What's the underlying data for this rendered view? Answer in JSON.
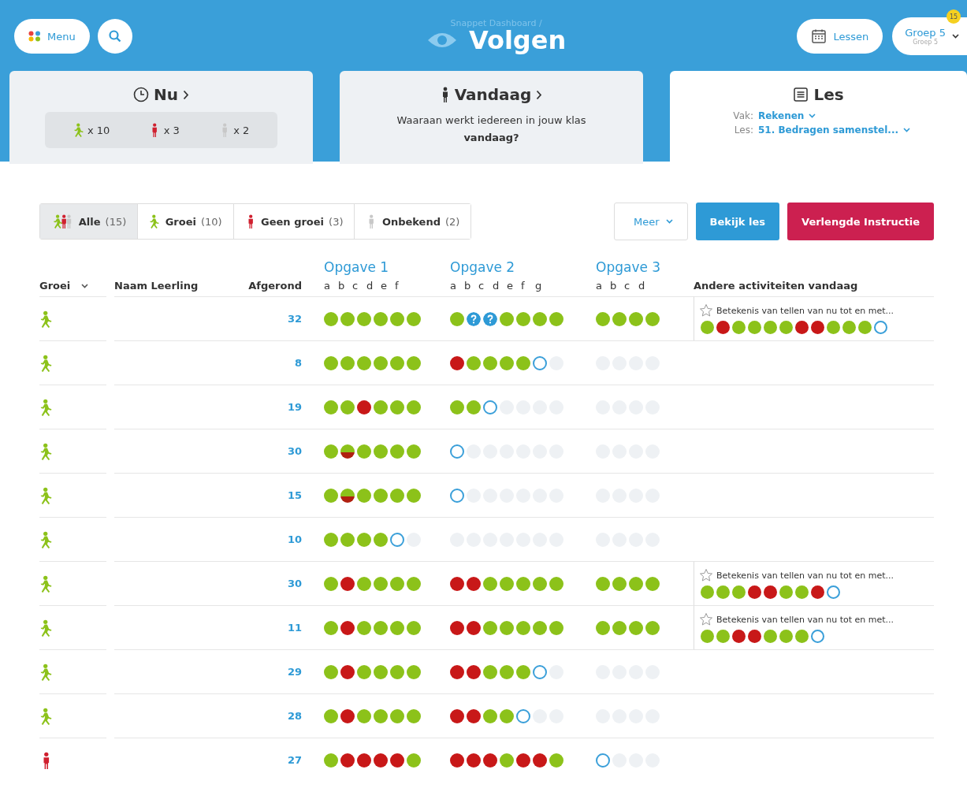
{
  "header": {
    "menu_button": "Menu",
    "breadcrumb": "Snappet Dashboard /",
    "title": "Volgen",
    "lessons_button": "Lessen",
    "group_selector": {
      "label": "Groep 5",
      "sublabel": "Groep 5",
      "badge": "15"
    }
  },
  "cards": [
    {
      "kind": "now",
      "title": "Nu",
      "selected": false,
      "counts": [
        {
          "kind": "growth",
          "text": "x 10"
        },
        {
          "kind": "no_growth",
          "text": "x 3"
        },
        {
          "kind": "unknown",
          "text": "x 2"
        }
      ]
    },
    {
      "kind": "today",
      "title": "Vandaag",
      "selected": false,
      "text": "Waaraan werkt iedereen in jouw klas **vandaag?**"
    },
    {
      "kind": "lesson",
      "title": "Les",
      "selected": true,
      "fields": [
        {
          "label": "Vak:",
          "value": "Rekenen"
        },
        {
          "label": "Les:",
          "value": "51. Bedragen samenstel..."
        }
      ]
    }
  ],
  "filters": [
    {
      "kind": "all",
      "label": "Alle",
      "count": "(15)",
      "selected": true
    },
    {
      "kind": "growth",
      "label": "Groei",
      "count": "(10)",
      "selected": false
    },
    {
      "kind": "no_growth",
      "label": "Geen groei",
      "count": "(3)",
      "selected": false
    },
    {
      "kind": "unknown",
      "label": "Onbekend",
      "count": "(2)",
      "selected": false
    }
  ],
  "actions": [
    {
      "kind": "dropdown",
      "label": "Meer"
    },
    {
      "kind": "primary",
      "label": "Bekijk les"
    },
    {
      "kind": "danger",
      "label": "Verlengde Instructie"
    }
  ],
  "table": {
    "columns": {
      "growth": "Groei",
      "name": "Naam Leerling",
      "done": "Afgerond",
      "other": "Andere activiteiten vandaag"
    },
    "exercises": [
      {
        "title": "Opgave 1",
        "parts": [
          "a",
          "b",
          "c",
          "d",
          "e",
          "f"
        ]
      },
      {
        "title": "Opgave 2",
        "parts": [
          "a",
          "b",
          "c",
          "d",
          "e",
          "f",
          "g"
        ]
      },
      {
        "title": "Opgave 3",
        "parts": [
          "a",
          "b",
          "c",
          "d"
        ]
      }
    ],
    "rows": [
      {
        "kind": "growth",
        "done": "32",
        "results": [
          [
            {
              "kind": "correct"
            },
            {
              "kind": "correct"
            },
            {
              "kind": "correct"
            },
            {
              "kind": "correct"
            },
            {
              "kind": "correct"
            },
            {
              "kind": "correct"
            }
          ],
          [
            {
              "kind": "correct"
            },
            {
              "kind": "question"
            },
            {
              "kind": "question"
            },
            {
              "kind": "correct"
            },
            {
              "kind": "correct"
            },
            {
              "kind": "correct"
            },
            {
              "kind": "correct"
            }
          ],
          [
            {
              "kind": "correct"
            },
            {
              "kind": "correct"
            },
            {
              "kind": "correct"
            },
            {
              "kind": "correct"
            }
          ]
        ],
        "other": {
          "title": "Betekenis van tellen van nu tot en met...",
          "results": [
            {
              "kind": "correct"
            },
            {
              "kind": "wrong"
            },
            {
              "kind": "correct"
            },
            {
              "kind": "correct"
            },
            {
              "kind": "correct"
            },
            {
              "kind": "correct"
            },
            {
              "kind": "wrong"
            },
            {
              "kind": "wrong"
            },
            {
              "kind": "correct"
            },
            {
              "kind": "correct"
            },
            {
              "kind": "correct"
            },
            {
              "kind": "open"
            }
          ]
        }
      },
      {
        "kind": "growth",
        "done": "8",
        "results": [
          [
            {
              "kind": "correct"
            },
            {
              "kind": "correct"
            },
            {
              "kind": "correct"
            },
            {
              "kind": "correct"
            },
            {
              "kind": "correct"
            },
            {
              "kind": "correct"
            }
          ],
          [
            {
              "kind": "wrong"
            },
            {
              "kind": "correct"
            },
            {
              "kind": "correct"
            },
            {
              "kind": "correct"
            },
            {
              "kind": "correct"
            },
            {
              "kind": "open"
            },
            {
              "kind": "empty"
            }
          ],
          [
            {
              "kind": "empty"
            },
            {
              "kind": "empty"
            },
            {
              "kind": "empty"
            },
            {
              "kind": "empty"
            }
          ]
        ]
      },
      {
        "kind": "growth",
        "done": "19",
        "results": [
          [
            {
              "kind": "correct"
            },
            {
              "kind": "correct"
            },
            {
              "kind": "wrong"
            },
            {
              "kind": "correct"
            },
            {
              "kind": "correct"
            },
            {
              "kind": "correct"
            }
          ],
          [
            {
              "kind": "correct"
            },
            {
              "kind": "correct"
            },
            {
              "kind": "open"
            },
            {
              "kind": "empty"
            },
            {
              "kind": "empty"
            },
            {
              "kind": "empty"
            },
            {
              "kind": "empty"
            }
          ],
          [
            {
              "kind": "empty"
            },
            {
              "kind": "empty"
            },
            {
              "kind": "empty"
            },
            {
              "kind": "empty"
            }
          ]
        ]
      },
      {
        "kind": "growth",
        "done": "30",
        "results": [
          [
            {
              "kind": "correct"
            },
            {
              "kind": "partial"
            },
            {
              "kind": "correct"
            },
            {
              "kind": "correct"
            },
            {
              "kind": "correct"
            },
            {
              "kind": "correct"
            }
          ],
          [
            {
              "kind": "open"
            },
            {
              "kind": "empty"
            },
            {
              "kind": "empty"
            },
            {
              "kind": "empty"
            },
            {
              "kind": "empty"
            },
            {
              "kind": "empty"
            },
            {
              "kind": "empty"
            }
          ],
          [
            {
              "kind": "empty"
            },
            {
              "kind": "empty"
            },
            {
              "kind": "empty"
            },
            {
              "kind": "empty"
            }
          ]
        ]
      },
      {
        "kind": "growth",
        "done": "15",
        "results": [
          [
            {
              "kind": "correct"
            },
            {
              "kind": "partial"
            },
            {
              "kind": "correct"
            },
            {
              "kind": "correct"
            },
            {
              "kind": "correct"
            },
            {
              "kind": "correct"
            }
          ],
          [
            {
              "kind": "open"
            },
            {
              "kind": "empty"
            },
            {
              "kind": "empty"
            },
            {
              "kind": "empty"
            },
            {
              "kind": "empty"
            },
            {
              "kind": "empty"
            },
            {
              "kind": "empty"
            }
          ],
          [
            {
              "kind": "empty"
            },
            {
              "kind": "empty"
            },
            {
              "kind": "empty"
            },
            {
              "kind": "empty"
            }
          ]
        ]
      },
      {
        "kind": "growth",
        "done": "10",
        "results": [
          [
            {
              "kind": "correct"
            },
            {
              "kind": "correct"
            },
            {
              "kind": "correct"
            },
            {
              "kind": "correct"
            },
            {
              "kind": "open"
            },
            {
              "kind": "empty"
            }
          ],
          [
            {
              "kind": "empty"
            },
            {
              "kind": "empty"
            },
            {
              "kind": "empty"
            },
            {
              "kind": "empty"
            },
            {
              "kind": "empty"
            },
            {
              "kind": "empty"
            },
            {
              "kind": "empty"
            }
          ],
          [
            {
              "kind": "empty"
            },
            {
              "kind": "empty"
            },
            {
              "kind": "empty"
            },
            {
              "kind": "empty"
            }
          ]
        ]
      },
      {
        "kind": "growth",
        "done": "30",
        "results": [
          [
            {
              "kind": "correct"
            },
            {
              "kind": "wrong"
            },
            {
              "kind": "correct"
            },
            {
              "kind": "correct"
            },
            {
              "kind": "correct"
            },
            {
              "kind": "correct"
            }
          ],
          [
            {
              "kind": "wrong"
            },
            {
              "kind": "wrong"
            },
            {
              "kind": "correct"
            },
            {
              "kind": "correct"
            },
            {
              "kind": "correct"
            },
            {
              "kind": "correct"
            },
            {
              "kind": "correct"
            }
          ],
          [
            {
              "kind": "correct"
            },
            {
              "kind": "correct"
            },
            {
              "kind": "correct"
            },
            {
              "kind": "correct"
            }
          ]
        ],
        "other": {
          "title": "Betekenis van tellen van nu tot en met...",
          "results": [
            {
              "kind": "correct"
            },
            {
              "kind": "correct"
            },
            {
              "kind": "correct"
            },
            {
              "kind": "wrong"
            },
            {
              "kind": "wrong"
            },
            {
              "kind": "correct"
            },
            {
              "kind": "correct"
            },
            {
              "kind": "wrong"
            },
            {
              "kind": "open"
            }
          ]
        }
      },
      {
        "kind": "growth",
        "done": "11",
        "results": [
          [
            {
              "kind": "correct"
            },
            {
              "kind": "wrong"
            },
            {
              "kind": "correct"
            },
            {
              "kind": "correct"
            },
            {
              "kind": "correct"
            },
            {
              "kind": "correct"
            }
          ],
          [
            {
              "kind": "wrong"
            },
            {
              "kind": "wrong"
            },
            {
              "kind": "correct"
            },
            {
              "kind": "correct"
            },
            {
              "kind": "correct"
            },
            {
              "kind": "correct"
            },
            {
              "kind": "correct"
            }
          ],
          [
            {
              "kind": "correct"
            },
            {
              "kind": "correct"
            },
            {
              "kind": "correct"
            },
            {
              "kind": "correct"
            }
          ]
        ],
        "other": {
          "title": "Betekenis van tellen van nu tot en met...",
          "results": [
            {
              "kind": "correct"
            },
            {
              "kind": "correct"
            },
            {
              "kind": "wrong"
            },
            {
              "kind": "wrong"
            },
            {
              "kind": "correct"
            },
            {
              "kind": "correct"
            },
            {
              "kind": "correct"
            },
            {
              "kind": "open"
            }
          ]
        }
      },
      {
        "kind": "growth",
        "done": "29",
        "results": [
          [
            {
              "kind": "correct"
            },
            {
              "kind": "wrong"
            },
            {
              "kind": "correct"
            },
            {
              "kind": "correct"
            },
            {
              "kind": "correct"
            },
            {
              "kind": "correct"
            }
          ],
          [
            {
              "kind": "wrong"
            },
            {
              "kind": "wrong"
            },
            {
              "kind": "correct"
            },
            {
              "kind": "correct"
            },
            {
              "kind": "correct"
            },
            {
              "kind": "open"
            },
            {
              "kind": "empty"
            }
          ],
          [
            {
              "kind": "empty"
            },
            {
              "kind": "empty"
            },
            {
              "kind": "empty"
            },
            {
              "kind": "empty"
            }
          ]
        ]
      },
      {
        "kind": "growth",
        "done": "28",
        "results": [
          [
            {
              "kind": "correct"
            },
            {
              "kind": "wrong"
            },
            {
              "kind": "correct"
            },
            {
              "kind": "correct"
            },
            {
              "kind": "correct"
            },
            {
              "kind": "correct"
            }
          ],
          [
            {
              "kind": "wrong"
            },
            {
              "kind": "wrong"
            },
            {
              "kind": "correct"
            },
            {
              "kind": "correct"
            },
            {
              "kind": "open"
            },
            {
              "kind": "empty"
            },
            {
              "kind": "empty"
            }
          ],
          [
            {
              "kind": "empty"
            },
            {
              "kind": "empty"
            },
            {
              "kind": "empty"
            },
            {
              "kind": "empty"
            }
          ]
        ]
      },
      {
        "kind": "no_growth",
        "done": "27",
        "results": [
          [
            {
              "kind": "correct"
            },
            {
              "kind": "wrong"
            },
            {
              "kind": "wrong"
            },
            {
              "kind": "wrong"
            },
            {
              "kind": "wrong"
            },
            {
              "kind": "correct"
            }
          ],
          [
            {
              "kind": "wrong"
            },
            {
              "kind": "wrong"
            },
            {
              "kind": "wrong"
            },
            {
              "kind": "correct"
            },
            {
              "kind": "wrong"
            },
            {
              "kind": "wrong"
            },
            {
              "kind": "correct"
            }
          ],
          [
            {
              "kind": "open"
            },
            {
              "kind": "empty"
            },
            {
              "kind": "empty"
            },
            {
              "kind": "empty"
            }
          ]
        ]
      }
    ]
  }
}
